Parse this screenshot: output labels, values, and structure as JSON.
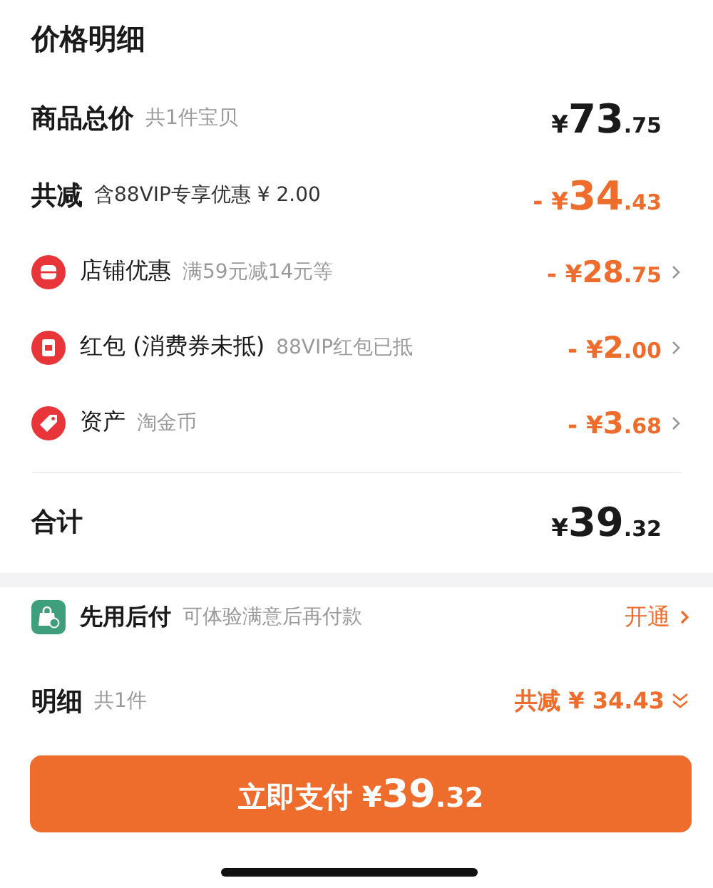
{
  "title": "价格明细",
  "subtotal": {
    "label": "商品总价",
    "note": "共1件宝贝",
    "price": {
      "currency": "¥",
      "integer": "73",
      "decimal": ".75"
    }
  },
  "discount_total": {
    "label": "共减",
    "note": "含88VIP专享优惠 ¥ 2.00",
    "price": {
      "sign": "- ",
      "currency": "¥",
      "integer": "34",
      "decimal": ".43"
    }
  },
  "discounts": [
    {
      "kind": "shop",
      "label": "店铺优惠",
      "note": "满59元减14元等",
      "price": {
        "sign": "- ",
        "currency": "¥",
        "integer": "28",
        "decimal": ".75"
      }
    },
    {
      "kind": "redpacket",
      "label": "红包 (消费券未抵)",
      "note": "88VIP红包已抵",
      "price": {
        "sign": "- ",
        "currency": "¥",
        "integer": "2",
        "decimal": ".00"
      }
    },
    {
      "kind": "tag",
      "label": "资产",
      "note": "淘金币",
      "price": {
        "sign": "- ",
        "currency": "¥",
        "integer": "3",
        "decimal": ".68"
      }
    }
  ],
  "total": {
    "label": "合计",
    "price": {
      "currency": "¥",
      "integer": "39",
      "decimal": ".32"
    }
  },
  "pay_later": {
    "label": "先用后付",
    "note": "可体验满意后再付款",
    "action": "开通"
  },
  "summary": {
    "label": "明细",
    "count": "共1件",
    "saving": "共减 ¥ 34.43"
  },
  "pay_button": {
    "label": "立即支付",
    "currency": "¥",
    "integer": "39",
    "decimal": ".32"
  }
}
